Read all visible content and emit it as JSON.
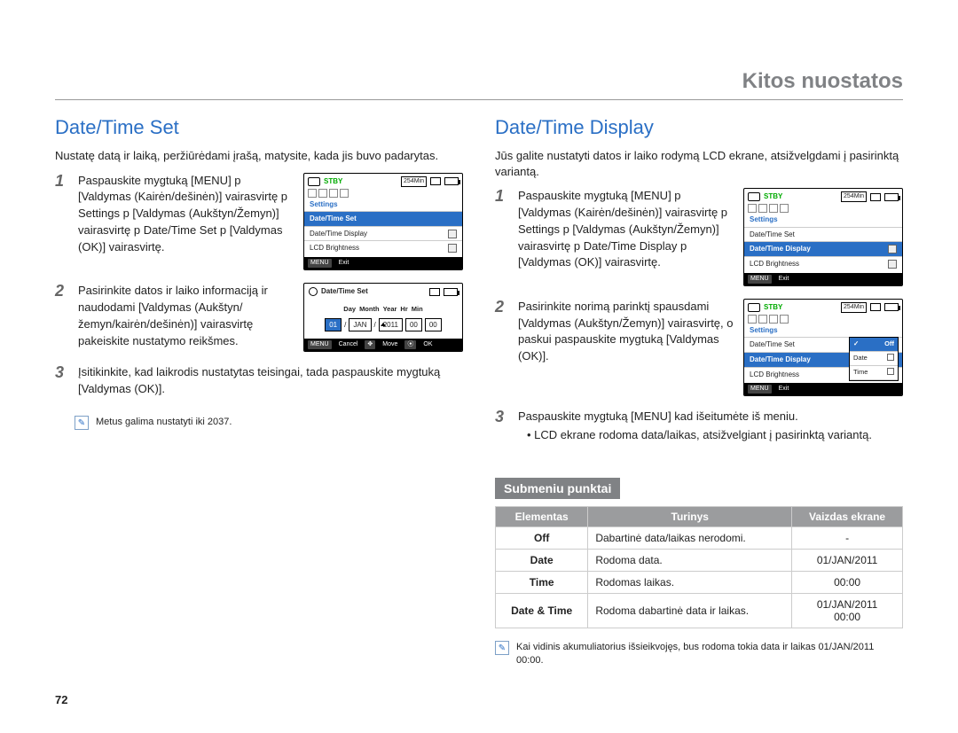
{
  "header": "Kitos nuostatos",
  "page_number": "72",
  "left": {
    "title": "Date/Time Set",
    "intro": "Nustatę datą ir laiką, peržiūrėdami įrašą, matysite, kada jis buvo padarytas.",
    "step1_num": "1",
    "step1_text": "Paspauskite mygtuką [MENU]  p [Valdymas (Kairėn/dešinėn)] vairasvirtę  p Settings  p [Valdymas (Aukštyn/Žemyn)] vairasvirtę  p Date/Time Set  p [Valdymas (OK)] vairasvirtę.",
    "step2_num": "2",
    "step2_text": "Pasirinkite datos ir laiko informaciją ir naudodami [Valdymas (Aukštyn/žemyn/kairėn/dešinėn)] vairasvirtę pakeiskite nustatymo reikšmes.",
    "step3_num": "3",
    "step3_text": "Įsitikinkite, kad laikrodis nustatytas teisingai, tada paspauskite mygtuką [Valdymas (OK)].",
    "note": "Metus galima nustatyti iki 2037.",
    "lcd1": {
      "stby": "STBY",
      "min": "254Min",
      "section": "Settings",
      "items": [
        "Date/Time Set",
        "Date/Time Display",
        "LCD Brightness"
      ],
      "menu": "MENU",
      "exit": "Exit"
    },
    "lcd2": {
      "title": "Date/Time Set",
      "cols": [
        "Day",
        "Month",
        "Year",
        "Hr",
        "Min"
      ],
      "vals": [
        "01",
        "JAN",
        "2011",
        "00",
        "00"
      ],
      "menu": "MENU",
      "cancel": "Cancel",
      "move": "Move",
      "ok": "OK"
    }
  },
  "right": {
    "title": "Date/Time Display",
    "intro": "Jūs galite nustatyti datos ir laiko rodymą LCD ekrane, atsižvelgdami į pasirinktą variantą.",
    "step1_num": "1",
    "step1_text": "Paspauskite mygtuką [MENU]  p [Valdymas (Kairėn/dešinėn)] vairasvirtę  p Settings  p [Valdymas (Aukštyn/Žemyn)] vairasvirtę  p Date/Time Display  p [Valdymas (OK)] vairasvirtę.",
    "step2_num": "2",
    "step2_text": "Pasirinkite norimą parinktį spausdami [Valdymas (Aukštyn/Žemyn)] vairasvirtę, o paskui paspauskite mygtuką [Valdymas (OK)].",
    "step3_num": "3",
    "step3_text": "Paspauskite mygtuką [MENU] kad išeitumėte iš meniu.",
    "step3_sub": "LCD ekrane rodoma data/laikas, atsižvelgiant į pasirinktą variantą.",
    "subheader": "Submeniu punktai",
    "table": {
      "headers": [
        "Elementas",
        "Turinys",
        "Vaizdas ekrane"
      ],
      "rows": [
        {
          "el": "Off",
          "tur": "Dabartinė data/laikas nerodomi.",
          "vd": "-"
        },
        {
          "el": "Date",
          "tur": "Rodoma data.",
          "vd": "01/JAN/2011"
        },
        {
          "el": "Time",
          "tur": "Rodomas laikas.",
          "vd": "00:00"
        },
        {
          "el": "Date & Time",
          "tur": "Rodoma dabartinė data ir laikas.",
          "vd": "01/JAN/2011\n00:00"
        }
      ]
    },
    "note": "Kai vidinis akumuliatorius išsieikvojęs, bus rodoma tokia data ir laikas 01/JAN/2011 00:00.",
    "lcd1": {
      "stby": "STBY",
      "min": "254Min",
      "section": "Settings",
      "items": [
        "Date/Time Set",
        "Date/Time Display",
        "LCD Brightness"
      ],
      "menu": "MENU",
      "exit": "Exit"
    },
    "lcd2": {
      "stby": "STBY",
      "min": "254Min",
      "section": "Settings",
      "items": [
        "Date/Time Set",
        "Date/Time Display",
        "LCD Brightness"
      ],
      "popup": [
        "Off",
        "Date",
        "Time"
      ],
      "menu": "MENU",
      "exit": "Exit"
    }
  }
}
